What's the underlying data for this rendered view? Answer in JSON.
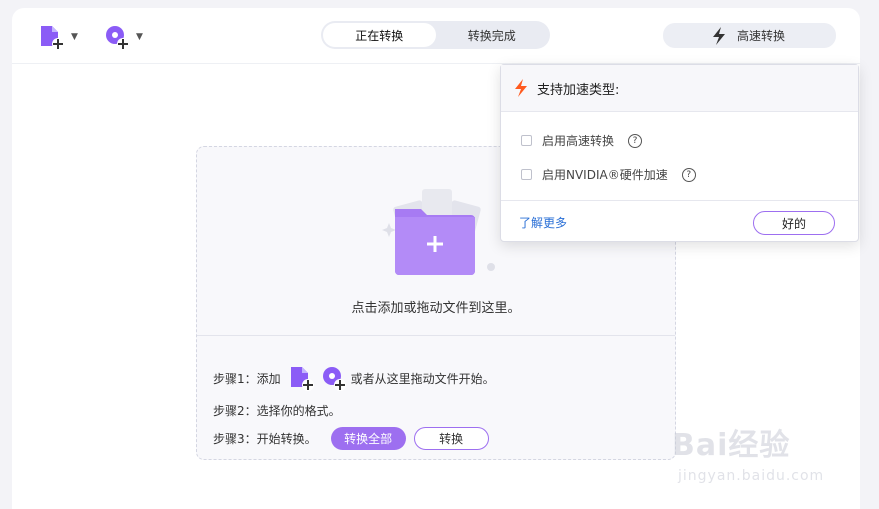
{
  "toolbar": {
    "add_file_icon": "add-file-icon",
    "add_disc_icon": "add-disc-icon",
    "tabs": [
      {
        "label": "正在转换",
        "active": true
      },
      {
        "label": "转换完成",
        "active": false
      }
    ],
    "speed_button_label": "高速转换"
  },
  "dropzone": {
    "prompt": "点击添加或拖动文件到这里。",
    "step1_prefix": "步骤1：添加",
    "step1_suffix": "或者从这里拖动文件开始。",
    "step2": "步骤2：选择你的格式。",
    "step3": "步骤3：开始转换。",
    "convert_all_label": "转换全部",
    "convert_label": "转换"
  },
  "popup": {
    "title": "支持加速类型:",
    "options": [
      {
        "label": "启用高速转换",
        "checked": false
      },
      {
        "label": "启用NVIDIA®硬件加速",
        "checked": false
      }
    ],
    "learn_more": "了解更多",
    "ok_label": "好的"
  },
  "watermark": {
    "brand": "Bai经验",
    "url": "jingyan.baidu.com"
  },
  "colors": {
    "accent": "#9d6ff0",
    "link": "#2a6fd6",
    "bolt": "#ff5a1f"
  }
}
